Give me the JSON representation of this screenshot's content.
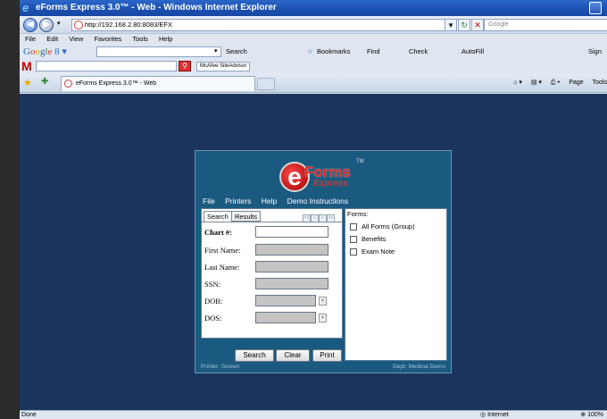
{
  "window": {
    "title": "eForms Express 3.0™ - Web - Windows Internet Explorer",
    "address": "http://192.168.2.80:8083/EFX",
    "search_placeholder": "Google"
  },
  "menubar": [
    "File",
    "Edit",
    "View",
    "Favorites",
    "Tools",
    "Help"
  ],
  "google_bar": {
    "logo": "Google",
    "search_label": "Search",
    "bookmarks": "Bookmarks",
    "find": "Find",
    "check": "Check",
    "autofill": "AutoFill",
    "sign": "Sign"
  },
  "mcafee": {
    "button": "McAfee SiteAdvisor"
  },
  "tab": {
    "label": "eForms Express 3.0™ - Web"
  },
  "cmdbar": {
    "page": "Page",
    "tools": "Tools"
  },
  "status": {
    "left": "Done",
    "zone": "Internet",
    "zoom": "100%"
  },
  "app": {
    "logo": {
      "forms": "Forms",
      "express": "Express",
      "tm": "TM"
    },
    "menu": [
      "File",
      "Printers",
      "Help",
      "Demo Instructions"
    ],
    "tabs": {
      "search": "Search",
      "results": "Results"
    },
    "pager": [
      "<<",
      "<",
      ">",
      ">>"
    ],
    "fields": {
      "chart": "Chart #:",
      "first_name": "First Name:",
      "last_name": "Last Name:",
      "ssn": "SSN:",
      "dob": "DOB:",
      "dos": "DOS:"
    },
    "forms_label": "Forms:",
    "forms": [
      "All Forms (Group)",
      "Benefits",
      "Exam Note"
    ],
    "buttons": {
      "search": "Search",
      "clear": "Clear",
      "print": "Print"
    },
    "footer_left": "Printer: Screen",
    "footer_right": "Dept: Medical Demo"
  }
}
